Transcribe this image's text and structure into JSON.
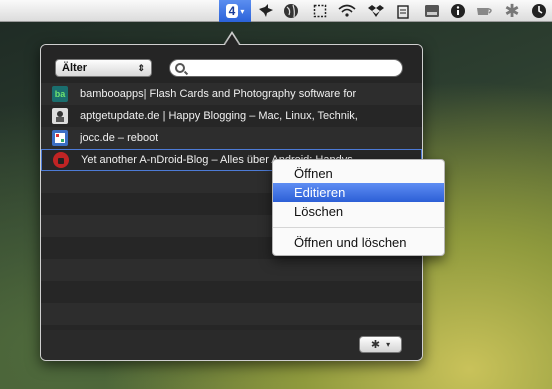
{
  "menubar": {
    "badge_count": "4",
    "badge_arrow": "▾",
    "icons": [
      "bird-icon",
      "globe-icon",
      "crop-icon",
      "wifi-icon",
      "dropbox-icon",
      "clipboard-icon",
      "drive-icon",
      "info-icon",
      "cup-icon",
      "asterisk-icon",
      "clock-icon"
    ]
  },
  "popover": {
    "sort_select": {
      "value": "Älter",
      "arrows": "⇕"
    },
    "search": {
      "placeholder": ""
    },
    "items": [
      {
        "favicon": "ba",
        "title": "bambooapps| Flash Cards and Photography software for"
      },
      {
        "favicon": "",
        "title": "aptgetupdate.de | Happy Blogging – Mac, Linux, Technik,"
      },
      {
        "favicon": "",
        "title": "jocc.de – reboot"
      },
      {
        "favicon": "",
        "title": "Yet another A-nDroid-Blog – Alles über Android: Handys,"
      }
    ],
    "gear_button": {
      "icon": "✱",
      "arrow": "▾"
    }
  },
  "context_menu": {
    "items": [
      {
        "label": "Öffnen"
      },
      {
        "label": "Editieren"
      },
      {
        "label": "Löschen"
      },
      {
        "label": "Öffnen und löschen"
      }
    ]
  },
  "colors": {
    "accent": "#2c5fd6",
    "popover_bg": "#2a2a2a"
  }
}
